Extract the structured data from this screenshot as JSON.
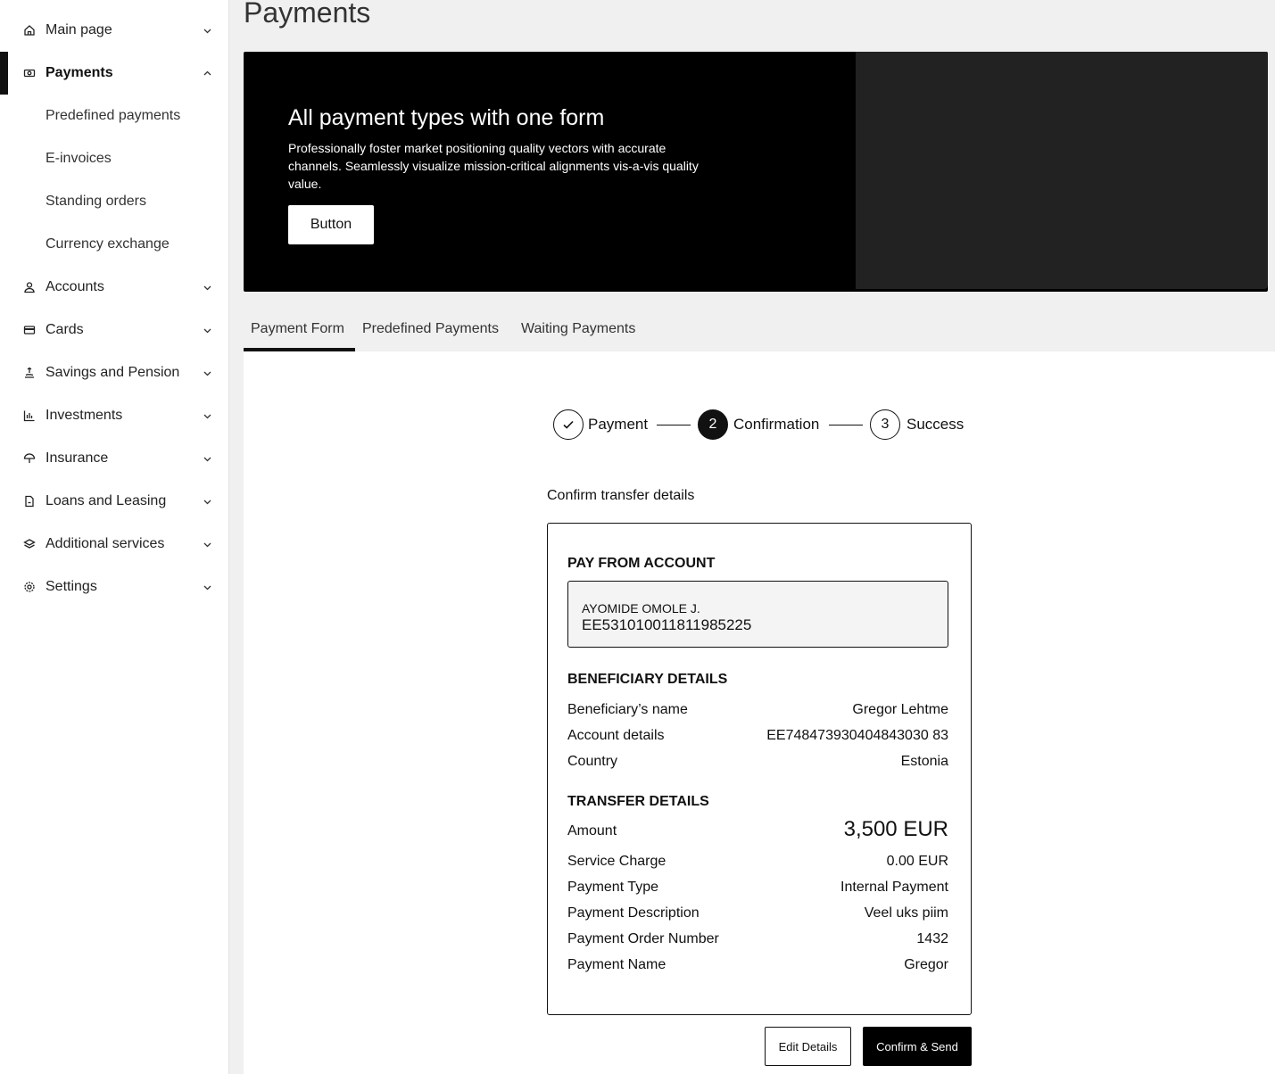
{
  "sidebar": {
    "items": [
      {
        "label": "Main page",
        "icon": "home-icon"
      },
      {
        "label": "Payments",
        "icon": "payments-icon"
      },
      {
        "label": "Accounts",
        "icon": "user-icon"
      },
      {
        "label": "Cards",
        "icon": "card-icon"
      },
      {
        "label": "Savings and Pension",
        "icon": "savings-icon"
      },
      {
        "label": "Investments",
        "icon": "chart-icon"
      },
      {
        "label": "Insurance",
        "icon": "umbrella-icon"
      },
      {
        "label": "Loans and Leasing",
        "icon": "document-icon"
      },
      {
        "label": "Additional services",
        "icon": "layers-icon"
      },
      {
        "label": "Settings",
        "icon": "gear-icon"
      }
    ],
    "payments_sub": [
      "Predefined payments",
      "E-invoices",
      "Standing orders",
      "Currency exchange"
    ]
  },
  "page": {
    "title": "Payments"
  },
  "hero": {
    "title": "All payment types with one form",
    "text": "Professionally foster market positioning quality vectors with accurate channels. Seamlessly visualize mission-critical alignments vis-a-vis quality value.",
    "button": "Button"
  },
  "tabs": [
    "Payment Form",
    "Predefined Payments",
    "Waiting Payments"
  ],
  "stepper": {
    "steps": [
      {
        "label": "Payment",
        "num": ""
      },
      {
        "label": "Confirmation",
        "num": "2"
      },
      {
        "label": "Success",
        "num": "3"
      }
    ]
  },
  "confirm": {
    "title": "Confirm transfer details",
    "pay_from_title": "PAY FROM ACCOUNT",
    "account_name": "AYOMIDE OMOLE J.",
    "account_number": "EE531010011811985225",
    "beneficiary_title": "BENEFICIARY DETAILS",
    "beneficiary": [
      {
        "k": "Beneficiary’s name",
        "v": "Gregor Lehtme"
      },
      {
        "k": "Account details",
        "v": "EE748473930404843030 83"
      },
      {
        "k": "Country",
        "v": "Estonia"
      }
    ],
    "transfer_title": "TRANSFER DETAILS",
    "amount_label": "Amount",
    "amount_value": "3,500 EUR",
    "transfer": [
      {
        "k": "Service Charge",
        "v": "0.00 EUR"
      },
      {
        "k": "Payment Type",
        "v": "Internal Payment"
      },
      {
        "k": "Payment Description",
        "v": "Veel uks piim"
      },
      {
        "k": "Payment Order Number",
        "v": "1432"
      },
      {
        "k": "Payment Name",
        "v": "Gregor"
      }
    ]
  },
  "actions": {
    "edit": "Edit Details",
    "confirm": "Confirm & Send"
  }
}
